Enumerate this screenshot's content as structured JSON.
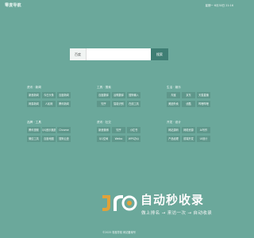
{
  "header": {
    "logo": "零度导航",
    "datetime": "星期一 6月30日 21:16"
  },
  "search": {
    "engine_label": "百度",
    "input_value": "",
    "placeholder": "",
    "button_label": "搜索"
  },
  "groups": [
    {
      "title": "资讯 · 新闻",
      "links": [
        "新浪新闻",
        "今日头条",
        "百度新闻",
        "网易新闻",
        "人民网",
        "腾讯新闻"
      ]
    },
    {
      "title": "工具 · 搜索",
      "links": [
        "百度翻译",
        "谷歌翻译",
        "搜狗输入",
        "知乎",
        "智能识别",
        "在线工具"
      ]
    },
    {
      "title": "生活 · 娱乐",
      "links": [
        "淘宝",
        "京东",
        "天猫直播",
        "美团外卖",
        "优酷",
        "哔哩哔哩"
      ]
    },
    {
      "title": "品牌 · 工具",
      "links": [
        "腾讯视频",
        "QQ音乐播放",
        "Chrome",
        "微信工具",
        "百度地图",
        "搜狗云盘"
      ]
    },
    {
      "title": "资讯 · 社交",
      "links": [
        "新浪微博",
        "知乎",
        "小红书",
        "QQ空间",
        "Weibo",
        "WPS办公"
      ]
    },
    {
      "title": "开发 · 设计",
      "links": [
        "网站源码",
        "网络资源",
        "Ai写作",
        "产品经理",
        "前端开发",
        "UI设计"
      ]
    }
  ],
  "watermark": {
    "title": "自动秒收录",
    "slogan": "做上排名 → 来访一次 → 自动收录",
    "logo_color": "#e0a23a"
  },
  "footer": {
    "text": "©2025 零度导航 网站备案号"
  }
}
